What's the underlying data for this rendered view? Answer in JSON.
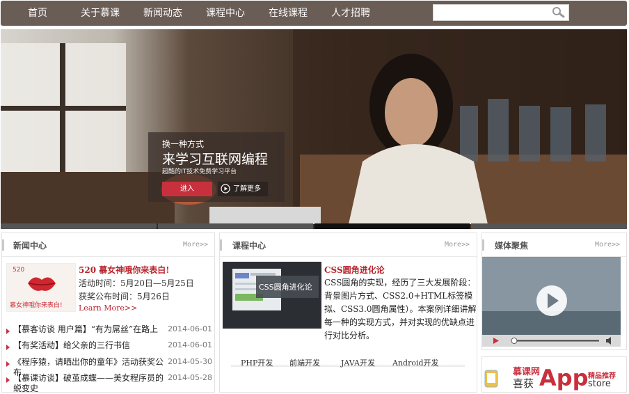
{
  "nav": {
    "items": [
      "首页",
      "关于慕课",
      "新闻动态",
      "课程中心",
      "在线课程",
      "人才招聘"
    ],
    "search_placeholder": ""
  },
  "hero": {
    "kicker": "换一种方式",
    "title": "来学习互联网编程",
    "subtitle": "超酷的IT技术免费学习平台",
    "enter_label": "进入",
    "more_label": "了解更多",
    "slides": 4,
    "active_slide": 3
  },
  "news": {
    "title": "新闻中心",
    "more": "More>>",
    "image_caption_top": "520",
    "image_caption_bottom": "慕女神哦你来表白!",
    "feature_title": "520 慕女神哦你来表白!",
    "feature_lines": [
      "活动时间：5月20日—5月25日",
      "获奖公布时间：5月26日"
    ],
    "learn_more": "Learn More>>",
    "items": [
      {
        "text": "【慕客访谈 用户篇】“有为屌丝”在路上",
        "date": "2014-06-01"
      },
      {
        "text": "【有奖活动】给父亲的三行书信",
        "date": "2014-06-01"
      },
      {
        "text": "《程序猿，请晒出你的童年》活动获奖公布",
        "date": "2014-05-30"
      },
      {
        "text": "【慕课访谈】破茧成蝶——美女程序员的蜕变史",
        "date": "2014-05-28"
      }
    ]
  },
  "course": {
    "title": "课程中心",
    "more": "More>>",
    "image_text": "CSS圆角进化论",
    "feature_title": "CSS圆角进化论",
    "feature_desc": "CSS圆角的实现，经历了三大发展阶段：背景图片方式、CSS2.0+HTML标签模拟、CSS3.0圆角属性）。本案例详细讲解每一种的实现方式，并对实现的优缺点进行对比分析。",
    "tabs": [
      "PHP开发",
      "前端开发",
      "JAVA开发",
      "Android开发"
    ]
  },
  "media": {
    "title": "媒体聚焦",
    "more": "More>>",
    "app_brand": "慕课网",
    "app_win": "喜获",
    "app_big": "App",
    "app_tag1": "精品推荐",
    "app_tag2": "store"
  },
  "colors": {
    "nav_bg": "#6a5d55",
    "accent_red": "#c9303d",
    "title_red": "#b8242c"
  }
}
